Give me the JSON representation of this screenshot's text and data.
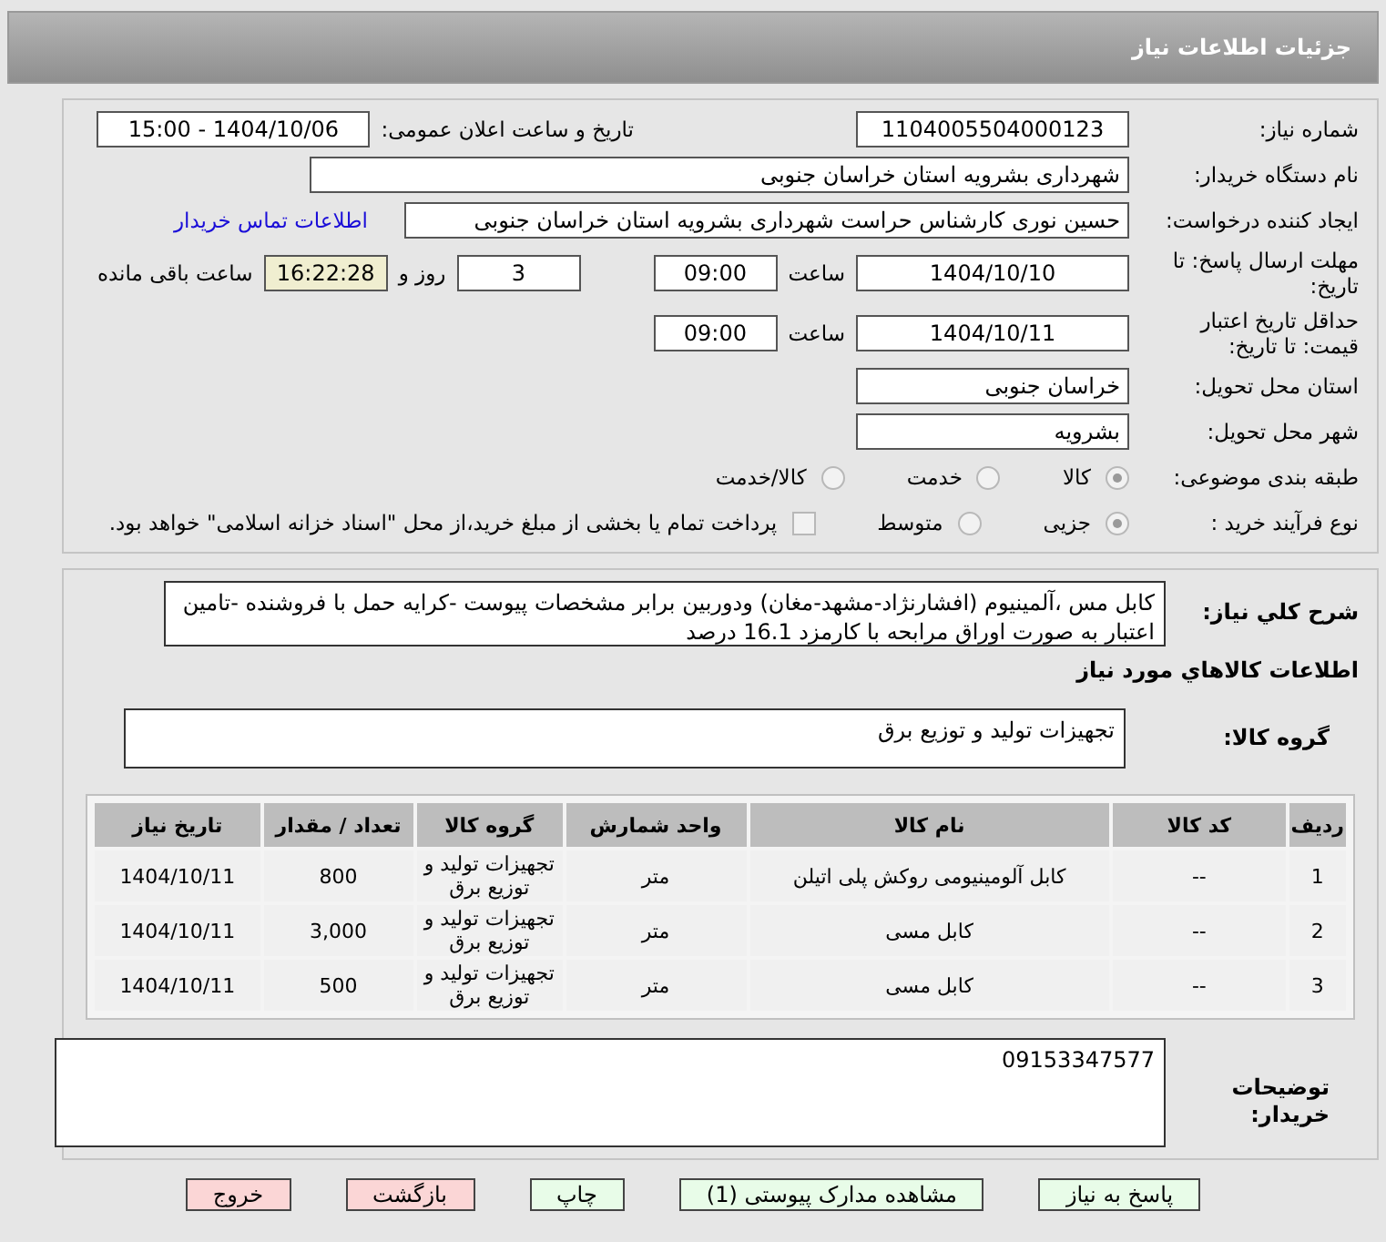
{
  "header": {
    "title": "جزئیات اطلاعات نیاز"
  },
  "need_number": {
    "label": "شماره نیاز:",
    "value": "1104005504000123"
  },
  "announce": {
    "label": "تاریخ و ساعت اعلان عمومی:",
    "value": "1404/10/06 - 15:00"
  },
  "buyer": {
    "label": "نام دستگاه خریدار:",
    "value": "شهرداری بشرویه استان خراسان جنوبی"
  },
  "requester": {
    "label": "ایجاد کننده درخواست:",
    "value": "حسین نوری کارشناس حراست شهرداری بشرویه استان خراسان جنوبی",
    "link": "اطلاعات تماس خریدار"
  },
  "deadline": {
    "label": "مهلت ارسال پاسخ: تا تاریخ:",
    "date": "1404/10/10",
    "time_label": "ساعت",
    "time": "09:00",
    "days": "3",
    "days_label": "روز و",
    "remaining": "16:22:28",
    "remaining_label": "ساعت باقی مانده"
  },
  "validity": {
    "label": "حداقل تاریخ اعتبار قیمت: تا تاریخ:",
    "date": "1404/10/11",
    "time_label": "ساعت",
    "time": "09:00"
  },
  "province": {
    "label": "استان محل تحویل:",
    "value": "خراسان جنوبی"
  },
  "city": {
    "label": "شهر محل تحویل:",
    "value": "بشرویه"
  },
  "category": {
    "label": "طبقه بندی موضوعی:",
    "options": [
      {
        "label": "کالا",
        "selected": true
      },
      {
        "label": "خدمت",
        "selected": false
      },
      {
        "label": "کالا/خدمت",
        "selected": false
      }
    ]
  },
  "process": {
    "label": "نوع فرآیند خرید :",
    "options": [
      {
        "label": "جزیی",
        "selected": true
      },
      {
        "label": "متوسط",
        "selected": false
      }
    ],
    "checkbox": {
      "label": "پرداخت تمام یا بخشی از مبلغ خرید،از محل \"اسناد خزانه اسلامی\" خواهد بود.",
      "checked": false
    }
  },
  "description": {
    "label": "شرح کلي نياز:",
    "value": "کابل مس ،آلمینیوم (افشارنژاد-مشهد-مغان) ودوربین برابر مشخصات پیوست -کرایه حمل با فروشنده -تامین اعتبار به صورت اوراق مرابحه با کارمزد 16.1 درصد"
  },
  "items_title": "اطلاعات کالاهاي مورد نياز",
  "goods_group": {
    "label": "گروه کالا:",
    "value": "تجهیزات تولید و توزیع برق"
  },
  "table": {
    "columns": [
      "ردیف",
      "کد کالا",
      "نام کالا",
      "واحد شمارش",
      "گروه کالا",
      "تعداد / مقدار",
      "تاریخ نیاز"
    ],
    "rows": [
      [
        "1",
        "--",
        "کابل آلومینیومی روکش پلی اتیلن",
        "متر",
        "تجهیزات تولید و توزیع برق",
        "800",
        "1404/10/11"
      ],
      [
        "2",
        "--",
        "کابل مسی",
        "متر",
        "تجهیزات تولید و توزیع برق",
        "3,000",
        "1404/10/11"
      ],
      [
        "3",
        "--",
        "کابل مسی",
        "متر",
        "تجهیزات تولید و توزیع برق",
        "500",
        "1404/10/11"
      ]
    ]
  },
  "buyer_notes": {
    "label": "توضیحات خریدار:",
    "value": "09153347577"
  },
  "buttons": [
    {
      "label": "پاسخ به نیاز",
      "kind": "normal"
    },
    {
      "label": "مشاهده مدارک پیوستی (1)",
      "kind": "normal"
    },
    {
      "label": "چاپ",
      "kind": "normal"
    },
    {
      "label": "بازگشت",
      "kind": "danger"
    },
    {
      "label": "خروج",
      "kind": "danger"
    }
  ]
}
